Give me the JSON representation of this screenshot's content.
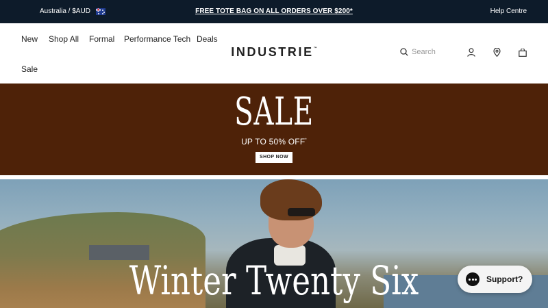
{
  "topbar": {
    "locale_label": "Australia / $AUD",
    "flag_icon": "australia-flag-icon",
    "promo_text": "FREE TOTE BAG ON ALL ORDERS OVER $200*",
    "help_label": "Help Centre",
    "background": "#0d1b2a"
  },
  "header": {
    "nav": [
      "New",
      "Shop All",
      "Formal",
      "Performance Tech",
      "Deals",
      "Sale"
    ],
    "logo_text": "INDUSTRIE",
    "logo_mark": "™",
    "search_placeholder": "Search",
    "icons": [
      "search-icon",
      "account-icon",
      "store-locator-icon",
      "bag-icon"
    ]
  },
  "sale_banner": {
    "title": "SALE",
    "subtitle": "UP TO 50% OFF",
    "subtitle_mark": "*",
    "cta_label": "SHOP NOW",
    "background": "#4e2208"
  },
  "hero": {
    "headline": "Winter Twenty Six"
  },
  "support_widget": {
    "label": "Support?",
    "icon": "chat-bubble-icon"
  }
}
